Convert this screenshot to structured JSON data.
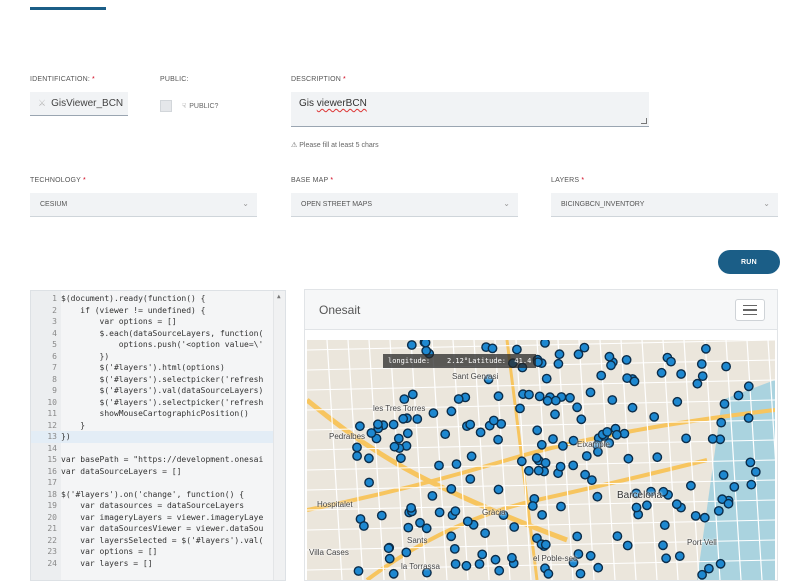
{
  "form": {
    "identification": {
      "label": "IDENTIFICATION:",
      "required": "*",
      "value": "GisViewer_BCN"
    },
    "public": {
      "label": "PUBLIC:",
      "checkbox_label": "PUBLIC?",
      "checked": false
    },
    "description": {
      "label": "DESCRIPTION",
      "required": "*",
      "value_prefix": "Gis ",
      "value_misspelled": "viewerBCN",
      "hint": "Please fill at least 5 chars"
    },
    "technology": {
      "label": "TECHNOLOGY",
      "required": "*",
      "value": "CESIUM"
    },
    "base_map": {
      "label": "BASE MAP",
      "required": "*",
      "value": "OPEN STREET MAPS"
    },
    "layers": {
      "label": "LAYERS",
      "required": "*",
      "value": "BICINGBCN_INVENTORY"
    }
  },
  "run_button": "RUN",
  "code_editor": {
    "lines": [
      {
        "n": "1",
        "t": "$(document).ready(function() {"
      },
      {
        "n": "2",
        "t": "    if (viewer != undefined) {"
      },
      {
        "n": "3",
        "t": "        var options = []"
      },
      {
        "n": "4",
        "t": "        $.each(dataSourceLayers, function("
      },
      {
        "n": "5",
        "t": "            options.push('<option value=\\'"
      },
      {
        "n": "6",
        "t": "        })"
      },
      {
        "n": "7",
        "t": "        $('#layers').html(options)"
      },
      {
        "n": "8",
        "t": "        $('#layers').selectpicker('refresh"
      },
      {
        "n": "9",
        "t": "        $('#layers').val(dataSourceLayers)"
      },
      {
        "n": "10",
        "t": "        $('#layers').selectpicker('refresh"
      },
      {
        "n": "11",
        "t": "        showMouseCartographicPosition()"
      },
      {
        "n": "12",
        "t": "    }"
      },
      {
        "n": "13",
        "t": "})"
      },
      {
        "n": "14",
        "t": ""
      },
      {
        "n": "15",
        "t": "var basePath = \"https://development.onesai"
      },
      {
        "n": "16",
        "t": "var dataSourceLayers = []"
      },
      {
        "n": "17",
        "t": ""
      },
      {
        "n": "18",
        "t": "$('#layers').on('change', function() {"
      },
      {
        "n": "19",
        "t": "    var datasources = dataSourceLayers"
      },
      {
        "n": "20",
        "t": "    var imageryLayers = viewer.imageryLaye"
      },
      {
        "n": "21",
        "t": "    var dataSourcesViewer = viewer.dataSou"
      },
      {
        "n": "22",
        "t": "    var layersSelected = $('#layers').val("
      },
      {
        "n": "23",
        "t": "    var options = []"
      },
      {
        "n": "24",
        "t": "    var layers = []"
      }
    ]
  },
  "map_panel": {
    "title": "Onesait",
    "coordinate_readout": "longitude:    2.12°Latitude:  41.4",
    "places": [
      "Sant Gervasi",
      "les Tres Torres",
      "Pedralbes",
      "Barcelona",
      "Port Vell",
      "Gràcia",
      "Eixample",
      "Sants",
      "el Poble-sec",
      "la Torrassa",
      "Villa Cases",
      "Hospitalet"
    ],
    "colors": {
      "marker_fill": "#1e88d0",
      "marker_stroke": "#0b2d4a",
      "water": "#aad3df",
      "road_major": "#f7c55f",
      "road_minor": "#ffffff",
      "land": "#ebe6dc"
    }
  }
}
